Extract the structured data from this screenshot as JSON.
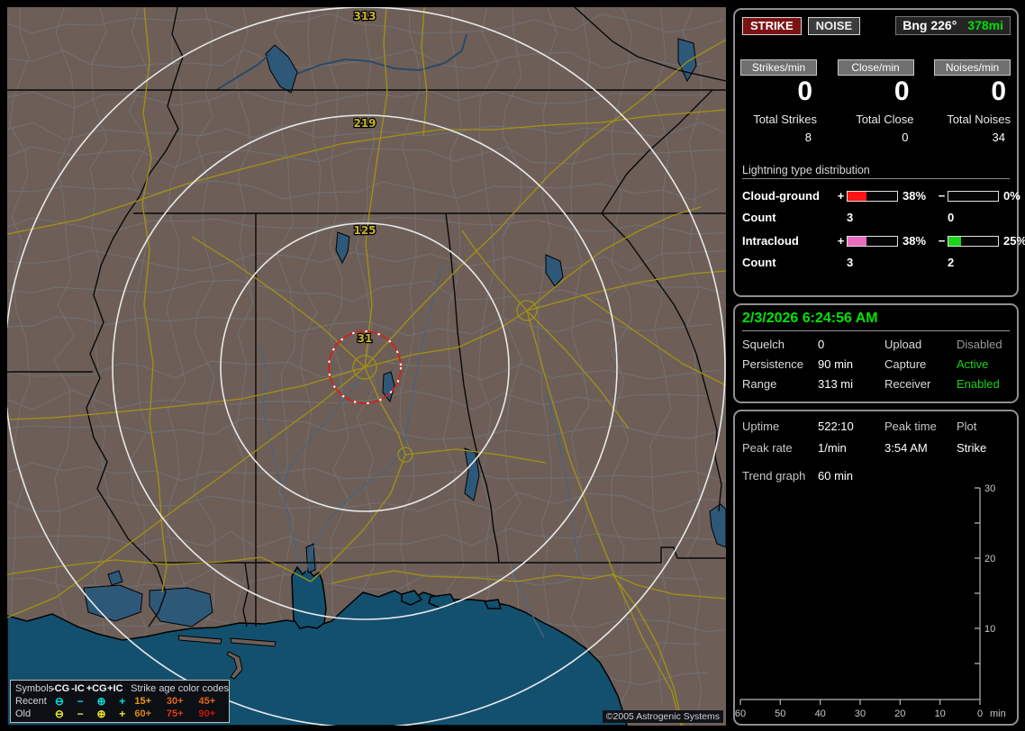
{
  "map": {
    "ring_labels": {
      "r313": "313",
      "r219": "219",
      "r125": "125",
      "r31": "31"
    },
    "legend": {
      "symbols_header": "Symbols",
      "col_headers": [
        "-CG",
        "-IC",
        "+CG",
        "+IC"
      ],
      "age_header": "Strike age color codes",
      "rows": [
        {
          "label": "Recent",
          "color": "#00e0e0",
          "sym_minus_cg": "⊖",
          "sym_minus_ic": "−",
          "sym_plus_cg": "⊕",
          "sym_plus_ic": "+",
          "ages": [
            {
              "text": "15+",
              "color": "#f09a18"
            },
            {
              "text": "30+",
              "color": "#e2661a"
            },
            {
              "text": "45+",
              "color": "#e2661a"
            }
          ]
        },
        {
          "label": "Old",
          "color": "#eaea20",
          "sym_minus_cg": "⊖",
          "sym_minus_ic": "−",
          "sym_plus_cg": "⊕",
          "sym_plus_ic": "+",
          "ages": [
            {
              "text": "60+",
              "color": "#dd8414"
            },
            {
              "text": "75+",
              "color": "#e03c14"
            },
            {
              "text": "90+",
              "color": "#c81408"
            }
          ]
        }
      ]
    },
    "copyright": "©2005 Astrogenic Systems"
  },
  "panel_top": {
    "strike_button": "STRIKE",
    "noise_button": "NOISE",
    "bearing_label": "Bng 226°",
    "bearing_distance": "378mi",
    "bearing_distance_color": "#00dd00",
    "counters": [
      {
        "box": "Strikes/min",
        "rate": "0",
        "total_label": "Total Strikes",
        "total": "8"
      },
      {
        "box": "Close/min",
        "rate": "0",
        "total_label": "Total Close",
        "total": "0"
      },
      {
        "box": "Noises/min",
        "rate": "0",
        "total_label": "Total Noises",
        "total": "34"
      }
    ],
    "distribution": {
      "title": "Lightning type distribution",
      "plus_sign": "+",
      "minus_sign": "−",
      "rows": [
        {
          "label": "Cloud-ground",
          "plus_pct": "38%",
          "plus_fill": 38,
          "plus_color": "#ff1414",
          "minus_pct": "0%",
          "minus_fill": 0,
          "minus_color": "#ff1414",
          "count_label": "Count",
          "plus_count": "3",
          "minus_count": "0"
        },
        {
          "label": "Intracloud",
          "plus_pct": "38%",
          "plus_fill": 38,
          "plus_color": "#e86cc0",
          "minus_pct": "25%",
          "minus_fill": 25,
          "minus_color": "#1ad41a",
          "count_label": "Count",
          "plus_count": "3",
          "minus_count": "2"
        }
      ]
    }
  },
  "panel_status": {
    "datetime": "2/3/2026 6:24:56 AM",
    "datetime_color": "#00e400",
    "rows": [
      {
        "l1": "Squelch",
        "v1": "0",
        "l2": "Upload",
        "v2": "Disabled",
        "v2_color": "#9a9a9a"
      },
      {
        "l1": "Persistence",
        "v1": "90 min",
        "l2": "Capture",
        "v2": "Active",
        "v2_color": "#16d416"
      },
      {
        "l1": "Range",
        "v1": "313 mi",
        "l2": "Receiver",
        "v2": "Enabled",
        "v2_color": "#16d416"
      }
    ]
  },
  "panel_trend": {
    "rows": [
      {
        "c1": "Uptime",
        "c2": "522:10",
        "c3": "Peak time",
        "c4": "Plot"
      },
      {
        "c1": "Peak rate",
        "c2": "1/min",
        "c3": "3:54 AM",
        "c4": "Strike"
      }
    ],
    "trend_label": "Trend graph",
    "trend_value": "60 min",
    "chart": {
      "type": "line",
      "series": [],
      "y_ticks": [
        "30",
        "20",
        "10"
      ],
      "x_ticks": [
        "60",
        "50",
        "40",
        "30",
        "20",
        "10",
        "0"
      ],
      "x_unit": "min",
      "ylim": [
        0,
        30
      ],
      "xlim": [
        60,
        0
      ]
    }
  }
}
